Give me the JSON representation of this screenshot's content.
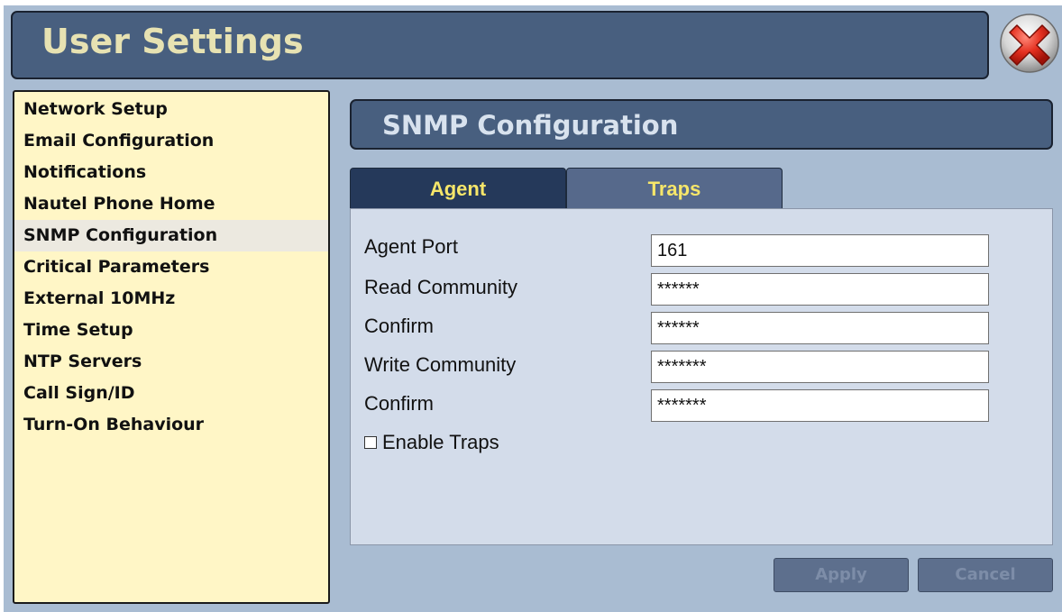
{
  "window": {
    "title": "User Settings"
  },
  "sidebar": {
    "items": [
      {
        "label": "Network Setup"
      },
      {
        "label": "Email Configuration"
      },
      {
        "label": "Notifications"
      },
      {
        "label": "Nautel Phone Home"
      },
      {
        "label": "SNMP Configuration",
        "selected": true
      },
      {
        "label": "Critical Parameters"
      },
      {
        "label": "External 10MHz"
      },
      {
        "label": "Time Setup"
      },
      {
        "label": "NTP Servers"
      },
      {
        "label": "Call Sign/ID"
      },
      {
        "label": "Turn-On Behaviour"
      }
    ]
  },
  "section": {
    "title": "SNMP Configuration"
  },
  "tabs": [
    {
      "label": "Agent",
      "active": true
    },
    {
      "label": "Traps",
      "active": false
    }
  ],
  "form": {
    "fields": [
      {
        "label": "Agent Port",
        "value": "161"
      },
      {
        "label": "Read Community",
        "value": "******"
      },
      {
        "label": "Confirm",
        "value": "******"
      },
      {
        "label": "Write Community",
        "value": "*******"
      },
      {
        "label": "Confirm",
        "value": "*******"
      }
    ],
    "enable_traps": {
      "label": "Enable Traps",
      "checked": false
    }
  },
  "buttons": {
    "apply": "Apply",
    "cancel": "Cancel"
  },
  "icons": {
    "close": "close-icon"
  },
  "colors": {
    "header": "#485f7f",
    "title_text": "#e7e2b2",
    "tab_text": "#f6e66a",
    "sidebar_bg": "#fff6c6",
    "close_red": "#e02525"
  }
}
